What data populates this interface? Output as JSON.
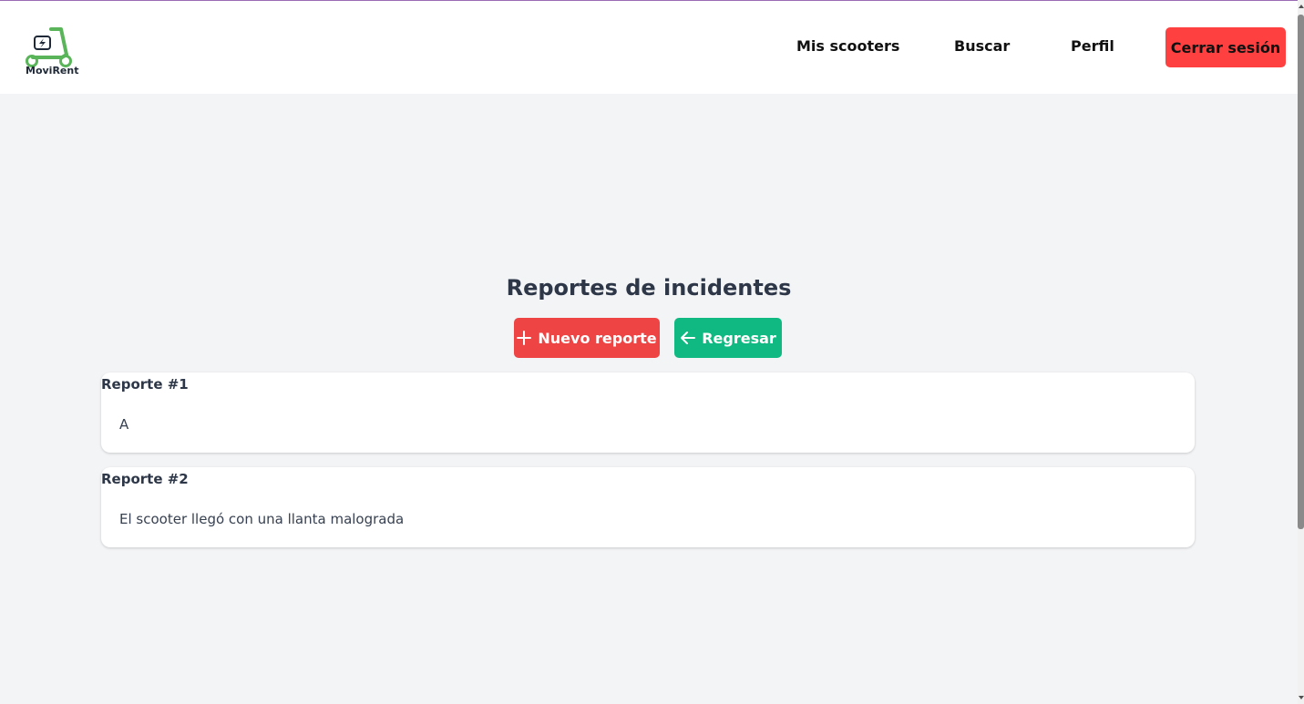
{
  "app": {
    "logo_text": "MoviRent",
    "logo_icon": "electric-scooter-icon",
    "brand_color": "#5ab55a"
  },
  "nav": {
    "items": [
      {
        "label": "Mis scooters"
      },
      {
        "label": "Buscar"
      },
      {
        "label": "Perfil"
      }
    ],
    "logout_label": "Cerrar sesión"
  },
  "page": {
    "title": "Reportes de incidentes",
    "new_report_label": "Nuevo reporte",
    "new_report_icon": "plus-icon",
    "back_label": "Regresar",
    "back_icon": "arrow-left-icon"
  },
  "reports": [
    {
      "title": "Reporte #1",
      "description": "A"
    },
    {
      "title": "Reporte #2",
      "description": "El scooter llegó con una llanta malograda"
    }
  ],
  "colors": {
    "logout": "#ff4040",
    "new_report": "#ef4444",
    "back": "#10b981",
    "background": "#f3f4f6"
  }
}
